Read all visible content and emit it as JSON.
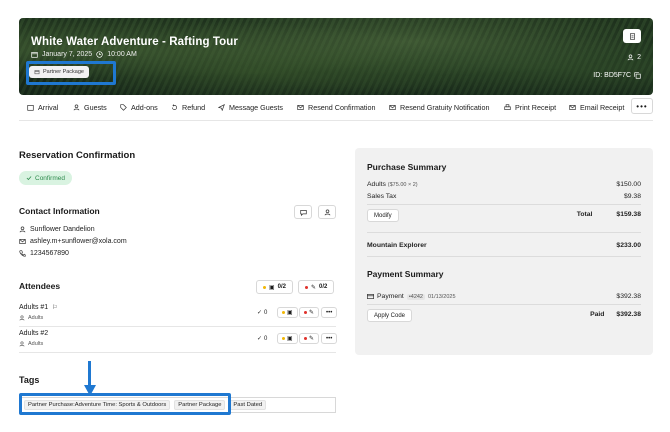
{
  "header": {
    "title": "White Water Adventure - Rafting Tour",
    "date": "January 7, 2025",
    "time": "10:00 AM",
    "partner_chip": "Partner Package",
    "guest_count": "2",
    "booking_id": "ID: BD5F7C"
  },
  "actions": [
    {
      "label": "Arrival",
      "icon": "calendar-icon"
    },
    {
      "label": "Guests",
      "icon": "user-icon"
    },
    {
      "label": "Add-ons",
      "icon": "tag-icon"
    },
    {
      "label": "Refund",
      "icon": "refund-icon"
    },
    {
      "label": "Message Guests",
      "icon": "send-icon"
    },
    {
      "label": "Resend Confirmation",
      "icon": "mail-icon"
    },
    {
      "label": "Resend Gratuity Notification",
      "icon": "mail-icon"
    },
    {
      "label": "Print Receipt",
      "icon": "printer-icon"
    },
    {
      "label": "Email Receipt",
      "icon": "mail-icon"
    }
  ],
  "more_label": "•••",
  "reservation": {
    "title": "Reservation Confirmation",
    "status": "Confirmed"
  },
  "contact": {
    "title": "Contact Information",
    "name": "Sunflower Dandelion",
    "email": "ashley.m+sunflower@xola.com",
    "phone": "1234567890"
  },
  "attendees": {
    "title": "Attendees",
    "waiver_count": "0/2",
    "form_count": "0/2",
    "rows": [
      {
        "name": "Adults #1",
        "type": "Adults",
        "checked": "0"
      },
      {
        "name": "Adults #2",
        "type": "Adults",
        "checked": "0"
      }
    ]
  },
  "tags": {
    "title": "Tags",
    "items": [
      "Partner Purchase:Adventure Time: Sports & Outdoors",
      "Partner Package",
      "Past Dated"
    ]
  },
  "purchase_summary": {
    "title": "Purchase Summary",
    "adults_label": "Adults",
    "adults_detail": "($75.00 × 2)",
    "adults_amount": "$150.00",
    "tax_label": "Sales Tax",
    "tax_amount": "$9.38",
    "modify_label": "Modify",
    "total_label": "Total",
    "total_amount": "$159.38",
    "partner_label": "Mountain Explorer",
    "partner_amount": "$233.00"
  },
  "payment_summary": {
    "title": "Payment Summary",
    "payment_label": "Payment",
    "card": "•4242",
    "date": "01/13/2025",
    "amount": "$392.38",
    "apply_code_label": "Apply Code",
    "paid_label": "Paid",
    "paid_amount": "$392.38"
  },
  "colors": {
    "highlight": "#1f78d1",
    "confirmed_bg": "#d9f3e1",
    "confirmed_text": "#2e8b4d",
    "waiver_dot": "#f2b705",
    "form_dot": "#e0322c"
  }
}
